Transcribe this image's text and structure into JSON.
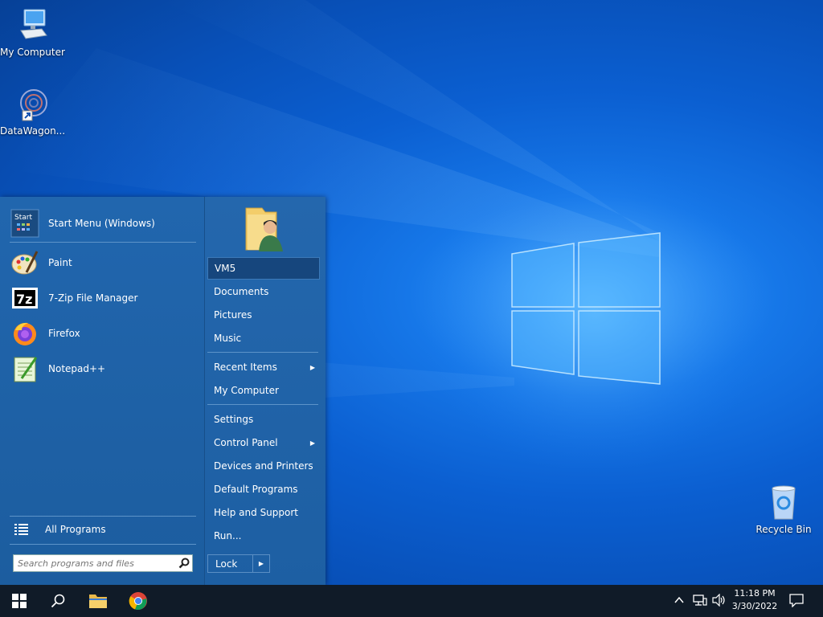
{
  "desktop": {
    "icons": [
      {
        "label": "My Computer",
        "icon": "computer-icon"
      },
      {
        "label": "DataWagon...",
        "icon": "datawagon-icon"
      },
      {
        "label": "Recycle Bin",
        "icon": "recycle-bin-icon"
      }
    ]
  },
  "start_menu": {
    "pinned": [
      {
        "label": "Start Menu (Windows)",
        "icon": "start-menu-icon"
      },
      {
        "label": "Paint",
        "icon": "paint-icon"
      },
      {
        "label": "7-Zip File Manager",
        "icon": "7zip-icon"
      },
      {
        "label": "Firefox",
        "icon": "firefox-icon"
      },
      {
        "label": "Notepad++",
        "icon": "notepadpp-icon"
      }
    ],
    "all_programs": "All Programs",
    "search_placeholder": "Search programs and files",
    "user": "VM5",
    "right_items": [
      {
        "label": "Documents"
      },
      {
        "label": "Pictures"
      },
      {
        "label": "Music"
      },
      {
        "label": "Recent Items",
        "submenu": true
      },
      {
        "label": "My Computer"
      },
      {
        "label": "Settings"
      },
      {
        "label": "Control Panel",
        "submenu": true
      },
      {
        "label": "Devices and Printers"
      },
      {
        "label": "Default Programs"
      },
      {
        "label": "Help and Support"
      },
      {
        "label": "Run..."
      }
    ],
    "lock_label": "Lock"
  },
  "taskbar": {
    "time": "11:18 PM",
    "date": "3/30/2022"
  },
  "colors": {
    "taskbar": "#101b28",
    "start_menu": "#1d5da1",
    "desktop_accent": "#0b5fd1"
  }
}
